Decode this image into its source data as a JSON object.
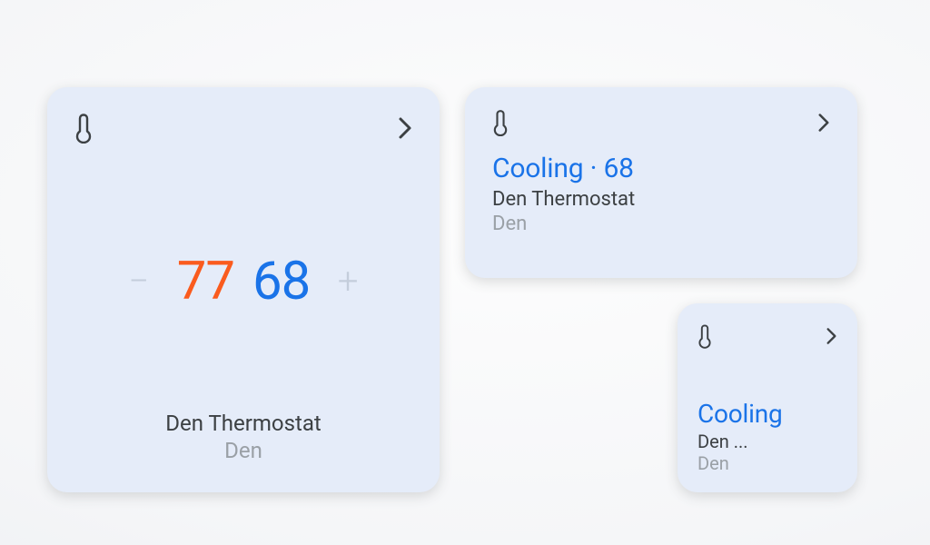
{
  "colors": {
    "card_bg": "#e5ecf9",
    "accent_cool": "#1a73e8",
    "accent_heat": "#fa5b1e",
    "text_primary": "#3c4043",
    "text_secondary": "#9aa0a6",
    "stepper": "#c4cddb"
  },
  "large_card": {
    "heat_temp": "77",
    "cool_temp": "68",
    "minus": "−",
    "plus": "+",
    "device_name": "Den Thermostat",
    "room_name": "Den"
  },
  "medium_card": {
    "status_line": "Cooling · 68",
    "device_name": "Den Thermostat",
    "room_name": "Den"
  },
  "small_card": {
    "status_line": "Cooling",
    "device_name": "Den ...",
    "room_name": "Den"
  }
}
